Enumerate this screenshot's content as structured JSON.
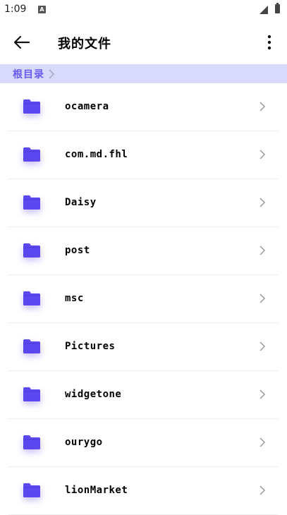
{
  "status_bar": {
    "time": "1:09",
    "notification_letter": "A"
  },
  "app_bar": {
    "title": "我的文件"
  },
  "breadcrumb": {
    "root_label": "根目录"
  },
  "colors": {
    "accent": "#6a5af2",
    "breadcrumb_bg": "#d9d9fb",
    "folder": "#5b48f0"
  },
  "folders": [
    {
      "name": "ocamera"
    },
    {
      "name": "com.md.fhl"
    },
    {
      "name": "Daisy"
    },
    {
      "name": "post"
    },
    {
      "name": "msc"
    },
    {
      "name": "Pictures"
    },
    {
      "name": "widgetone"
    },
    {
      "name": "ourygo"
    },
    {
      "name": "lionMarket"
    }
  ]
}
